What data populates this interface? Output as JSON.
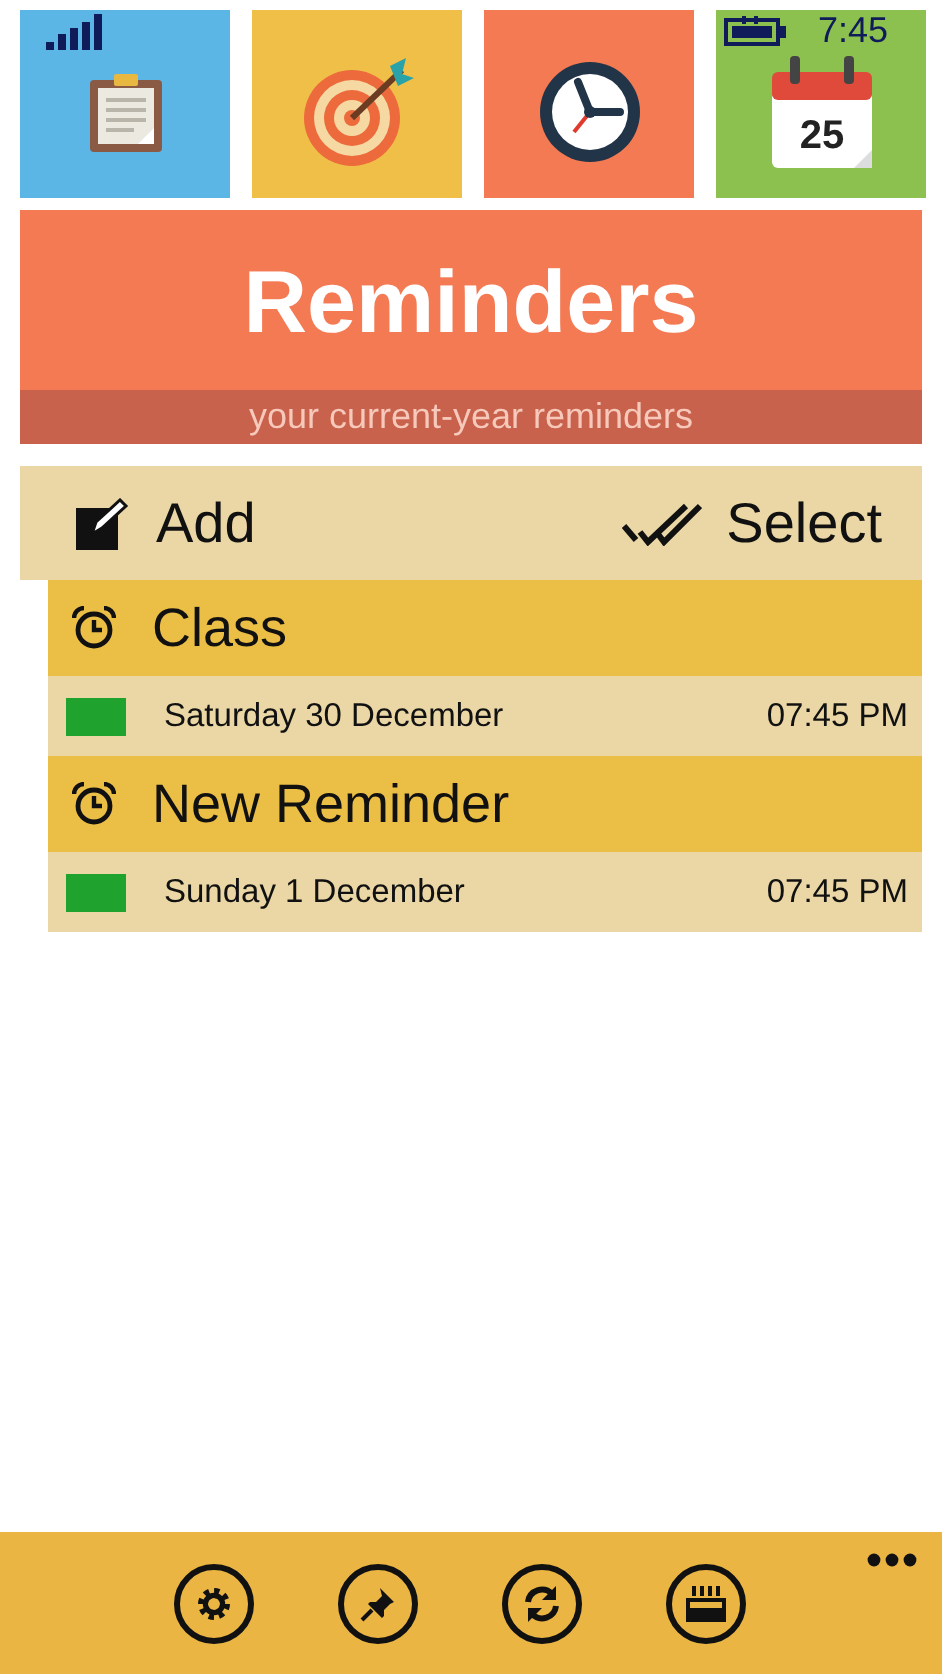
{
  "status_bar": {
    "time": "7:45"
  },
  "tiles": [
    {
      "kind": "clipboard",
      "color": "#5bb6e6"
    },
    {
      "kind": "target",
      "color": "#f0bf48"
    },
    {
      "kind": "clock",
      "color": "#f47a54"
    },
    {
      "kind": "calendar",
      "color": "#8cc04f",
      "text": "25"
    }
  ],
  "banner": {
    "title": "Reminders",
    "subtitle": "your current-year reminders"
  },
  "toolbar": {
    "add": "Add",
    "select": "Select"
  },
  "reminders": [
    {
      "title": "Class",
      "date": "Saturday 30 December",
      "time": "07:45 PM",
      "color": "#1fa22e"
    },
    {
      "title": "New Reminder",
      "date": "Sunday 1 December",
      "time": "07:45 PM",
      "color": "#1fa22e"
    }
  ],
  "app_bar": {
    "buttons": [
      {
        "kind": "settings"
      },
      {
        "kind": "pin"
      },
      {
        "kind": "sync"
      },
      {
        "kind": "cake"
      }
    ]
  }
}
